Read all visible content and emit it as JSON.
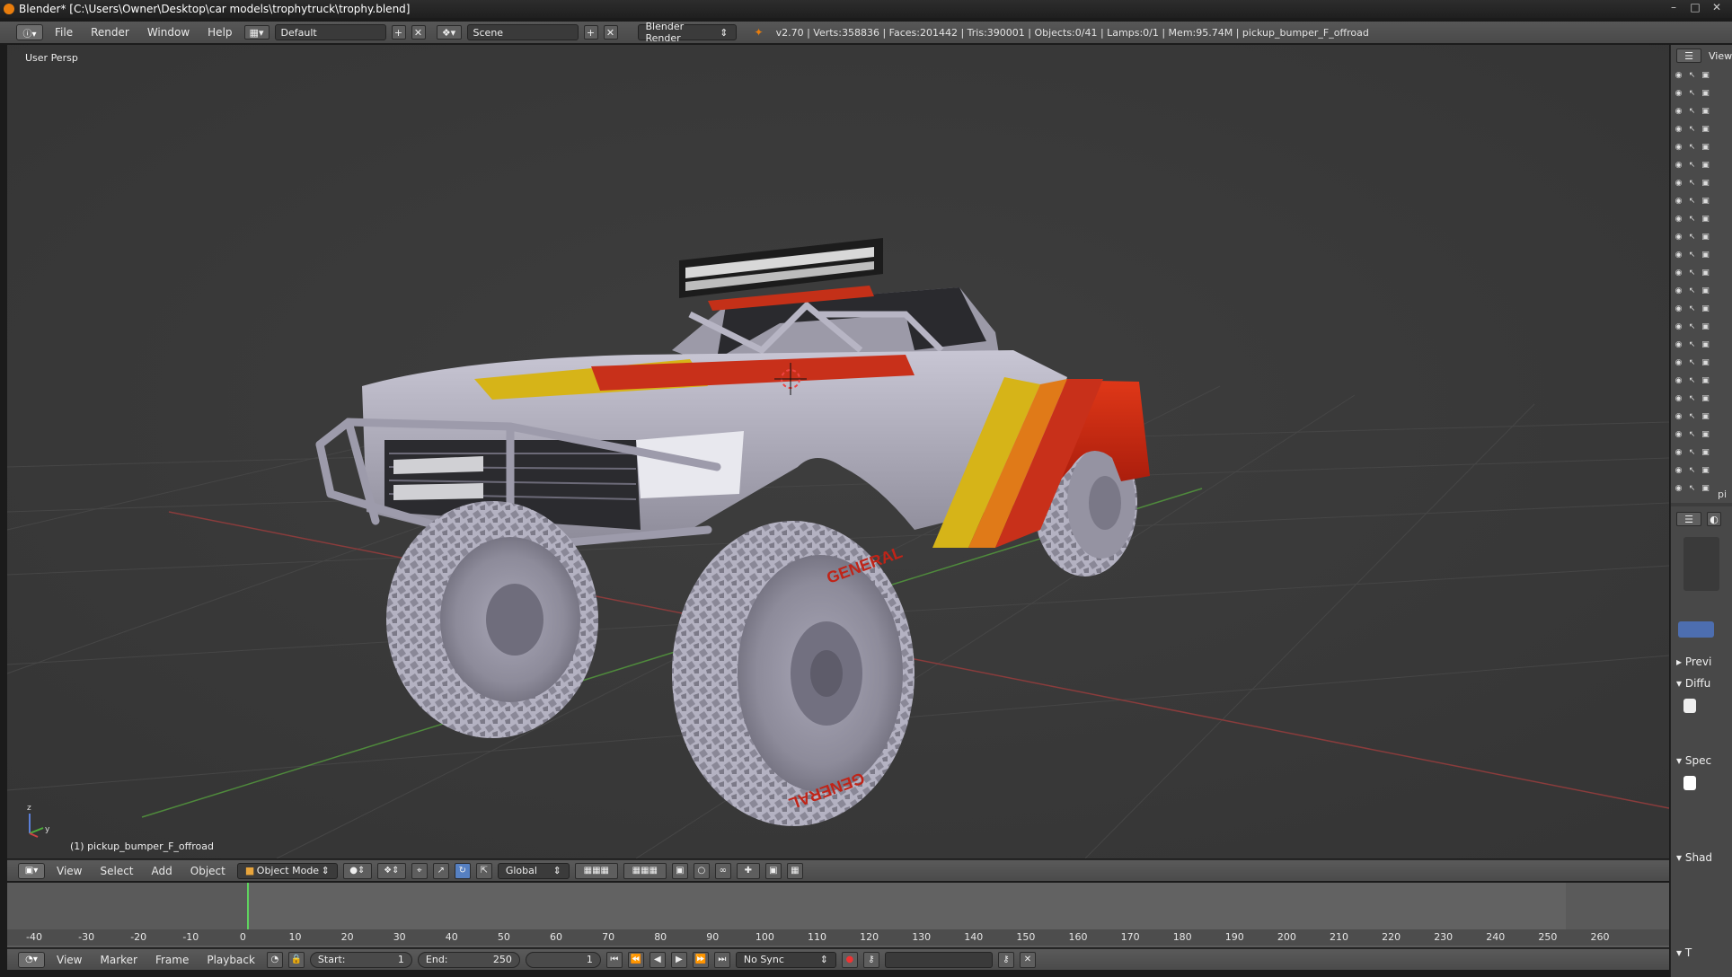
{
  "titlebar": {
    "text": "Blender* [C:\\Users\\Owner\\Desktop\\car models\\trophytruck\\trophy.blend]"
  },
  "info": {
    "menus": [
      "File",
      "Render",
      "Window",
      "Help"
    ],
    "layout": "Default",
    "scene": "Scene",
    "engine": "Blender Render",
    "stats": "v2.70 | Verts:358836 | Faces:201442 | Tris:390001 | Objects:0/41 | Lamps:0/1 | Mem:95.74M | pickup_bumper_F_offroad"
  },
  "viewport": {
    "label": "User Persp",
    "object_name": "(1) pickup_bumper_F_offroad",
    "axis_z": "z",
    "axis_y": "y",
    "tire_brand": "GENERAL"
  },
  "view_header": {
    "menus": [
      "View",
      "Select",
      "Add",
      "Object"
    ],
    "mode": "Object Mode",
    "orientation": "Global"
  },
  "timeline": {
    "ticks": [
      "-40",
      "-30",
      "-20",
      "-10",
      "0",
      "10",
      "20",
      "30",
      "40",
      "50",
      "60",
      "70",
      "80",
      "90",
      "100",
      "110",
      "120",
      "130",
      "140",
      "150",
      "160",
      "170",
      "180",
      "190",
      "200",
      "210",
      "220",
      "230",
      "240",
      "250",
      "260"
    ]
  },
  "timeline_header": {
    "menus": [
      "View",
      "Marker",
      "Frame",
      "Playback"
    ],
    "start_label": "Start:",
    "start_value": "1",
    "end_label": "End:",
    "end_value": "250",
    "current_frame": "1",
    "sync": "No Sync"
  },
  "right_panel": {
    "tab_view": "View",
    "outliner_partial": "pi",
    "sections": [
      "Previ",
      "Diffu",
      "Spec",
      "Shad",
      "T"
    ]
  }
}
